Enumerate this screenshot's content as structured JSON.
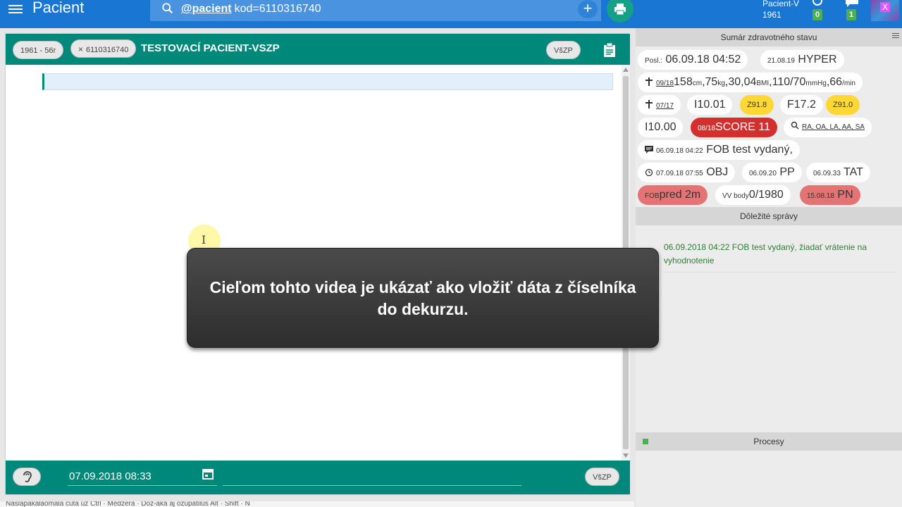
{
  "topbar": {
    "app_title": "Pacient",
    "search_key": "@pacient",
    "search_value": "kod=6110316740",
    "add_label": "+",
    "patient_name": "Pacient-V",
    "patient_year": "1961",
    "notif_count": "0",
    "msg_count": "1",
    "logo_glyph": "X"
  },
  "patient_header": {
    "chip_age": "1961 - 56r",
    "chip_id_close": "×",
    "chip_id": "6110316740",
    "title": "TESTOVACÍ PACIENT-VSZP",
    "insurer": "VšZP"
  },
  "footer": {
    "date": "07.09.2018 08:33",
    "insurer": "VšZP"
  },
  "caret_glyph": "I",
  "summary": {
    "title": "Sumár zdravotného stavu",
    "row1": {
      "posl_label": "Posl.:",
      "posl_value": "06.09.18 04:52",
      "hyper_date": "21.08.19",
      "hyper_label": "HYPER"
    },
    "row2": {
      "date": "09/18",
      "height": "158",
      "height_unit": "cm",
      "weight": ",75",
      "weight_unit": "kg",
      "bmi": ",30,04",
      "bmi_unit": "BMI",
      "bp": ",110/70",
      "bp_unit": "mmHg",
      "pulse": ",66",
      "pulse_unit": "/min"
    },
    "row3": {
      "date": "07/17",
      "diag1": "I10.01",
      "z1": "Z91.8",
      "diag2": "F17.2",
      "z2": "Z91.0"
    },
    "row4": {
      "diag": "I10.00",
      "score_date": "08/18",
      "score_label": "SCORE 11",
      "exams": "RA, OA, LA, AA, SA"
    },
    "row5": {
      "date": "06.09.18 04:22",
      "text": "FOB test vydaný,"
    },
    "row6": {
      "obj_date": "07.09.18 07:55",
      "obj_label": "OBJ",
      "pp_date": "06.09.20",
      "pp_label": "PP",
      "tat_date": "06.09.33",
      "tat_label": "TAT"
    },
    "row7": {
      "fob_prefix": "FOB",
      "fob_label": "pred 2m",
      "vv_prefix": "VV body",
      "vv_value": "0/1980",
      "pn_date": "15.08.18",
      "pn_label": "PN"
    }
  },
  "important": {
    "title": "Dôležité správy",
    "message": "06.09.2018 04:22 FOB test vydaný, žiadať vrátenie na vyhodnotenie"
  },
  "processes": {
    "title": "Procesy"
  },
  "overlay": {
    "text": "Cieľom tohto videa je ukázať ako vložiť dáta z číselníka do dekurzu."
  },
  "bottom_hint": "Nasläpakalaomala cuta uz Ctrl · Medzera · Doz-äka aj ozupatiluš Alt · Shift · N",
  "colors": {
    "topbar": "#1976d2",
    "teal": "#00897b",
    "red": "#d32f2f",
    "yellow": "#fdd835",
    "pink": "#e57373",
    "green": "#4caf50"
  },
  "icons": [
    "menu-icon",
    "search-icon",
    "plus-icon",
    "print-icon",
    "alarm-icon",
    "chat-icon",
    "close-icon",
    "clipboard-icon",
    "ear-icon",
    "calendar-icon",
    "cross-icon",
    "magnifier-icon",
    "comment-icon",
    "clock-icon",
    "lines-icon"
  ]
}
